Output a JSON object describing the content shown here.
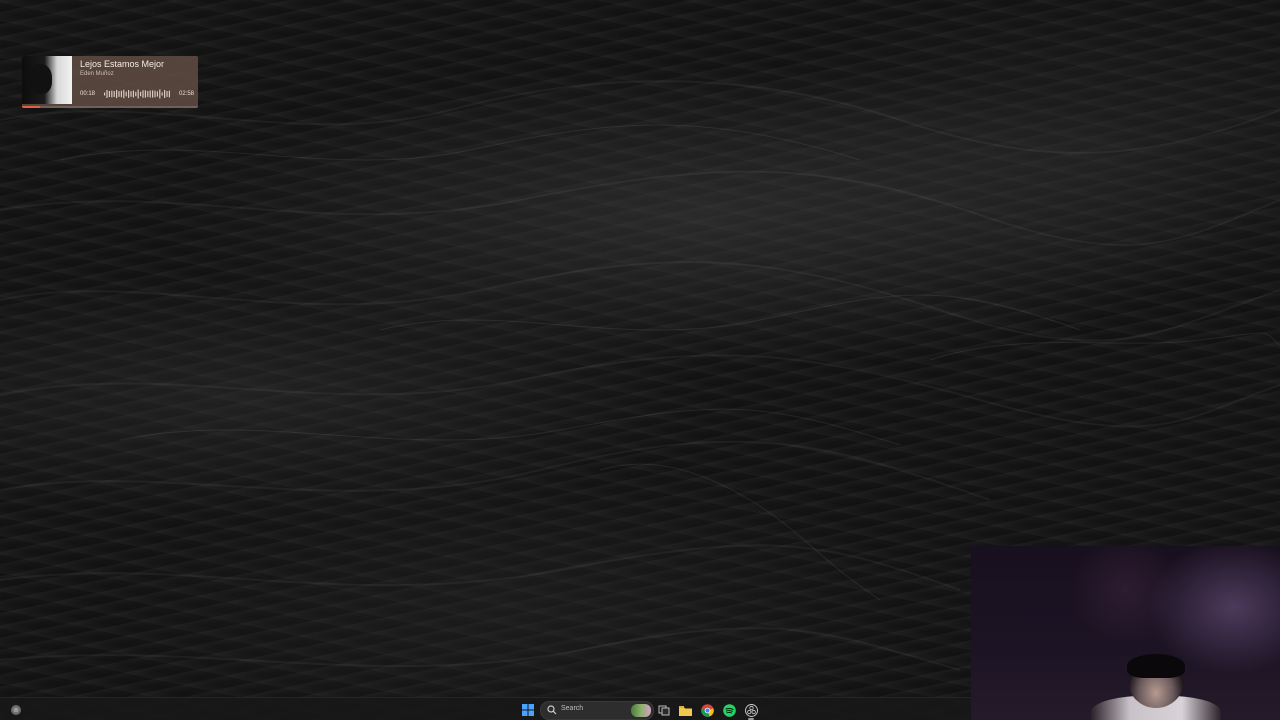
{
  "music_widget": {
    "track_title": "Lejos Estamos Mejor",
    "artist": "Eden Muñoz",
    "time_current": "00:18",
    "time_total": "02:58",
    "progress_fraction": 0.1,
    "accent_color": "#e06048",
    "background_color": "#5f4b41"
  },
  "taskbar": {
    "search_placeholder": "Search",
    "items": [
      {
        "name": "widgets",
        "icon": "widgets-icon"
      },
      {
        "name": "start",
        "icon": "windows-start-icon"
      },
      {
        "name": "search",
        "icon": "search-icon"
      },
      {
        "name": "task-view",
        "icon": "task-view-icon"
      },
      {
        "name": "file-explorer",
        "icon": "folder-icon"
      },
      {
        "name": "chrome",
        "icon": "chrome-icon"
      },
      {
        "name": "spotify",
        "icon": "spotify-icon"
      },
      {
        "name": "obs-studio",
        "icon": "obs-icon"
      }
    ],
    "colors": {
      "start": "#4aa3ff",
      "folder": "#f2c94c",
      "spotify": "#1ed760"
    }
  }
}
